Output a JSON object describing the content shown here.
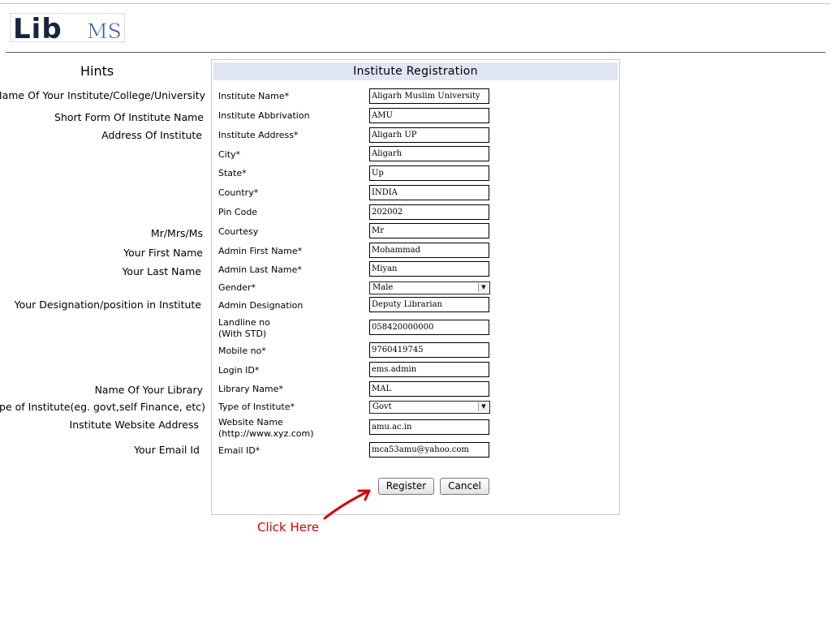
{
  "logo": {
    "text_lib": "Lib",
    "text_ms": "MS"
  },
  "hints": {
    "title": "Hints",
    "institute_name": "Name Of Your Institute/College/University",
    "short_form": "Short Form Of Institute Name",
    "address": "Address Of Institute",
    "courtesy": "Mr/Mrs/Ms",
    "first_name": "Your First Name",
    "last_name": "Your Last Name",
    "designation": "Your Designation/position in Institute",
    "library_name": "Name Of Your Library",
    "institute_type": "Type of Institute(eg. govt,self Finance, etc)",
    "website": "Institute Website Address",
    "email": "Your Email Id"
  },
  "form": {
    "title": "Institute Registration",
    "fields": {
      "institute_name": {
        "label": "Institute Name*",
        "value": "Aligarh Muslim University"
      },
      "abbreviation": {
        "label": "Institute Abbrivation",
        "value": "AMU"
      },
      "address": {
        "label": "Institute Address*",
        "value": "Aligarh UP"
      },
      "city": {
        "label": "City*",
        "value": "Aligarh"
      },
      "state": {
        "label": "State*",
        "value": "Up"
      },
      "country": {
        "label": "Country*",
        "value": "INDIA"
      },
      "pin": {
        "label": "Pin Code",
        "value": "202002"
      },
      "courtesy": {
        "label": "Courtesy",
        "value": "Mr"
      },
      "first_name": {
        "label": "Admin First Name*",
        "value": "Mohammad"
      },
      "last_name": {
        "label": "Admin Last Name*",
        "value": "Miyan"
      },
      "gender": {
        "label": "Gender*",
        "value": "Male"
      },
      "designation": {
        "label": "Admin Designation",
        "value": "Deputy Librarian"
      },
      "landline": {
        "label_line1": "Landline no",
        "label_line2": "(With STD)",
        "value": "058420000000"
      },
      "mobile": {
        "label": "Mobile no*",
        "value": "9760419745"
      },
      "login": {
        "label": "Login ID*",
        "value": "ems.admin"
      },
      "library": {
        "label": "Library Name*",
        "value": "MAL"
      },
      "type": {
        "label": "Type of Institute*",
        "value": "Govt"
      },
      "website": {
        "label_line1": "Website Name",
        "label_line2": "(http://www.xyz.com)",
        "value": "amu.ac.in"
      },
      "email": {
        "label": "Email ID*",
        "value": "mca53amu@yahoo.com"
      }
    },
    "buttons": {
      "register": "Register",
      "cancel": "Cancel"
    }
  },
  "annotation": {
    "text": "Click Here",
    "color": "#d40000"
  },
  "colors": {
    "header_bg": "#dfe5f2",
    "logo_dark": "#16243f",
    "logo_blue": "#3f5f9e"
  }
}
